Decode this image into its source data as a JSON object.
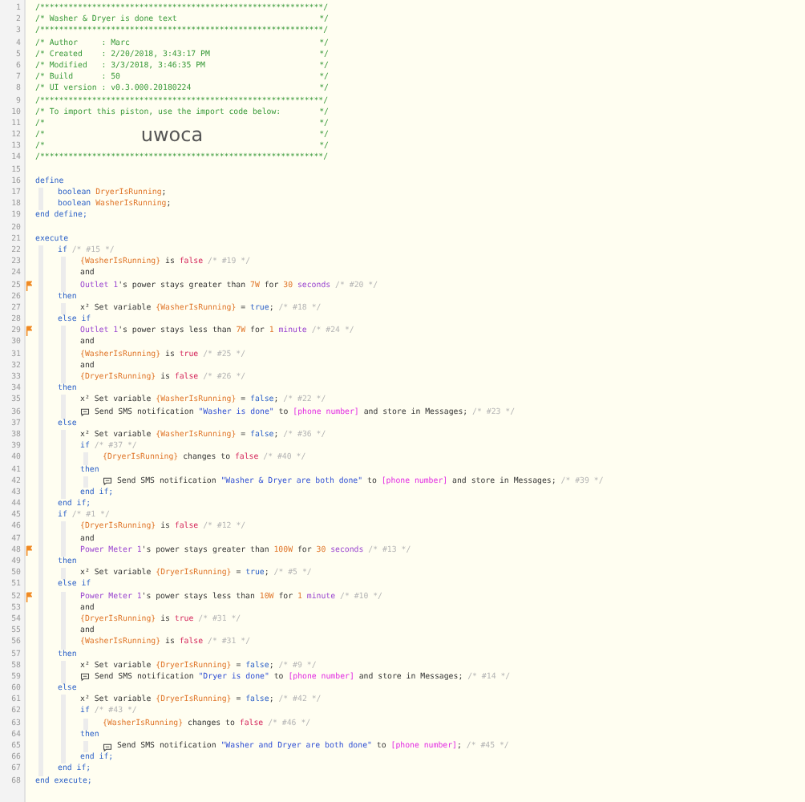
{
  "lines": [
    {
      "number": "1",
      "flagged": false,
      "tokens": [
        {
          "kind": "comment",
          "text": "/************************************************************/"
        }
      ]
    },
    {
      "number": "2",
      "flagged": false,
      "tokens": [
        {
          "kind": "comment",
          "text": "/* Washer & Dryer is done text"
        },
        {
          "kind": "comment-end",
          "text": "*/"
        }
      ]
    },
    {
      "number": "3",
      "flagged": false,
      "tokens": [
        {
          "kind": "comment",
          "text": "/************************************************************/"
        }
      ]
    },
    {
      "number": "4",
      "flagged": false,
      "tokens": [
        {
          "kind": "comment",
          "text": "/* Author     : Marc"
        },
        {
          "kind": "comment-end",
          "text": "*/"
        }
      ]
    },
    {
      "number": "5",
      "flagged": false,
      "tokens": [
        {
          "kind": "comment",
          "text": "/* Created    : 2/20/2018, 3:43:17 PM"
        },
        {
          "kind": "comment-end",
          "text": "*/"
        }
      ]
    },
    {
      "number": "6",
      "flagged": false,
      "tokens": [
        {
          "kind": "comment",
          "text": "/* Modified   : 3/3/2018, 3:46:35 PM"
        },
        {
          "kind": "comment-end",
          "text": "*/"
        }
      ]
    },
    {
      "number": "7",
      "flagged": false,
      "tokens": [
        {
          "kind": "comment",
          "text": "/* Build      : 50"
        },
        {
          "kind": "comment-end",
          "text": "*/"
        }
      ]
    },
    {
      "number": "8",
      "flagged": false,
      "tokens": [
        {
          "kind": "comment",
          "text": "/* UI version : v0.3.000.20180224"
        },
        {
          "kind": "comment-end",
          "text": "*/"
        }
      ]
    },
    {
      "number": "9",
      "flagged": false,
      "tokens": [
        {
          "kind": "comment",
          "text": "/************************************************************/"
        }
      ]
    },
    {
      "number": "10",
      "flagged": false,
      "tokens": [
        {
          "kind": "comment",
          "text": "/* To import this piston, use the import code below:"
        },
        {
          "kind": "comment-end",
          "text": "*/"
        }
      ]
    },
    {
      "number": "11",
      "flagged": false,
      "tokens": [
        {
          "kind": "comment",
          "text": "/*"
        },
        {
          "kind": "comment-end",
          "text": "*/"
        }
      ]
    },
    {
      "number": "12",
      "flagged": false,
      "tokens": [
        {
          "kind": "comment",
          "text": "/*"
        },
        {
          "kind": "banner",
          "text": "uwoca"
        },
        {
          "kind": "comment-end",
          "text": "*/"
        }
      ]
    },
    {
      "number": "13",
      "flagged": false,
      "tokens": [
        {
          "kind": "comment",
          "text": "/*"
        },
        {
          "kind": "comment-end",
          "text": "*/"
        }
      ]
    },
    {
      "number": "14",
      "flagged": false,
      "tokens": [
        {
          "kind": "comment",
          "text": "/************************************************************/"
        }
      ]
    },
    {
      "number": "15",
      "flagged": false
    },
    {
      "number": "16",
      "flagged": false,
      "tokens": [
        {
          "kind": "keyword",
          "text": "define"
        }
      ],
      "children": [
        {
          "number": "17",
          "flagged": false,
          "tokens": [
            {
              "kind": "keyword",
              "text": "boolean "
            },
            {
              "kind": "variable",
              "text": "DryerIsRunning"
            },
            {
              "kind": "plain",
              "text": ";"
            }
          ]
        },
        {
          "number": "18",
          "flagged": false,
          "tokens": [
            {
              "kind": "keyword",
              "text": "boolean "
            },
            {
              "kind": "variable",
              "text": "WasherIsRunning"
            },
            {
              "kind": "plain",
              "text": ";"
            }
          ]
        }
      ]
    },
    {
      "number": "19",
      "flagged": false,
      "tokens": [
        {
          "kind": "keyword",
          "text": "end define;"
        }
      ]
    },
    {
      "number": "20",
      "flagged": false
    },
    {
      "number": "21",
      "flagged": false,
      "tokens": [
        {
          "kind": "keyword",
          "text": "execute"
        }
      ],
      "children": [
        {
          "number": "22",
          "flagged": false,
          "tokens": [
            {
              "kind": "keyword",
              "text": "if "
            },
            {
              "kind": "note",
              "text": "/* #15 */"
            }
          ],
          "children": [
            {
              "number": "23",
              "flagged": false,
              "tokens": [
                {
                  "kind": "variable",
                  "text": "{WasherIsRunning}"
                },
                {
                  "kind": "plain",
                  "text": " is "
                },
                {
                  "kind": "bool",
                  "text": "false"
                },
                {
                  "kind": "note",
                  "text": " /* #19 */"
                }
              ]
            },
            {
              "number": "24",
              "flagged": false,
              "tokens": [
                {
                  "kind": "plain",
                  "text": "and"
                }
              ]
            },
            {
              "number": "25",
              "flagged": true,
              "tokens": [
                {
                  "kind": "device",
                  "text": "Outlet 1"
                },
                {
                  "kind": "plain",
                  "text": "'s power stays greater than "
                },
                {
                  "kind": "number",
                  "text": "7W"
                },
                {
                  "kind": "plain",
                  "text": " for "
                },
                {
                  "kind": "number",
                  "text": "30"
                },
                {
                  "kind": "unit",
                  "text": " seconds"
                },
                {
                  "kind": "note",
                  "text": " /* #20 */"
                }
              ]
            }
          ]
        },
        {
          "number": "26",
          "flagged": false,
          "tokens": [
            {
              "kind": "keyword",
              "text": "then"
            }
          ],
          "children": [
            {
              "number": "27",
              "flagged": false,
              "tokens": [
                {
                  "kind": "symbol",
                  "text": "x²"
                },
                {
                  "kind": "plain",
                  "text": " Set variable "
                },
                {
                  "kind": "variable",
                  "text": "{WasherIsRunning}"
                },
                {
                  "kind": "plain",
                  "text": " = "
                },
                {
                  "kind": "keyword",
                  "text": "true"
                },
                {
                  "kind": "plain",
                  "text": ";"
                },
                {
                  "kind": "note",
                  "text": " /* #18 */"
                }
              ]
            }
          ]
        },
        {
          "number": "28",
          "flagged": false,
          "tokens": [
            {
              "kind": "keyword",
              "text": "else if"
            }
          ],
          "children": [
            {
              "number": "29",
              "flagged": true,
              "tokens": [
                {
                  "kind": "device",
                  "text": "Outlet 1"
                },
                {
                  "kind": "plain",
                  "text": "'s power stays less than "
                },
                {
                  "kind": "number",
                  "text": "7W"
                },
                {
                  "kind": "plain",
                  "text": " for "
                },
                {
                  "kind": "number",
                  "text": "1"
                },
                {
                  "kind": "unit",
                  "text": " minute"
                },
                {
                  "kind": "note",
                  "text": " /* #24 */"
                }
              ]
            },
            {
              "number": "30",
              "flagged": false,
              "tokens": [
                {
                  "kind": "plain",
                  "text": "and"
                }
              ]
            },
            {
              "number": "31",
              "flagged": false,
              "tokens": [
                {
                  "kind": "variable",
                  "text": "{WasherIsRunning}"
                },
                {
                  "kind": "plain",
                  "text": " is "
                },
                {
                  "kind": "bool",
                  "text": "true"
                },
                {
                  "kind": "note",
                  "text": " /* #25 */"
                }
              ]
            },
            {
              "number": "32",
              "flagged": false,
              "tokens": [
                {
                  "kind": "plain",
                  "text": "and"
                }
              ]
            },
            {
              "number": "33",
              "flagged": false,
              "tokens": [
                {
                  "kind": "variable",
                  "text": "{DryerIsRunning}"
                },
                {
                  "kind": "plain",
                  "text": " is "
                },
                {
                  "kind": "bool",
                  "text": "false"
                },
                {
                  "kind": "note",
                  "text": " /* #26 */"
                }
              ]
            }
          ]
        },
        {
          "number": "34",
          "flagged": false,
          "tokens": [
            {
              "kind": "keyword",
              "text": "then"
            }
          ],
          "children": [
            {
              "number": "35",
              "flagged": false,
              "tokens": [
                {
                  "kind": "symbol",
                  "text": "x²"
                },
                {
                  "kind": "plain",
                  "text": " Set variable "
                },
                {
                  "kind": "variable",
                  "text": "{WasherIsRunning}"
                },
                {
                  "kind": "plain",
                  "text": " = "
                },
                {
                  "kind": "keyword",
                  "text": "false"
                },
                {
                  "kind": "plain",
                  "text": ";"
                },
                {
                  "kind": "note",
                  "text": " /* #22 */"
                }
              ]
            },
            {
              "number": "36",
              "flagged": false,
              "tokens": [
                {
                  "kind": "sms-icon"
                },
                {
                  "kind": "plain",
                  "text": " Send SMS notification "
                },
                {
                  "kind": "string",
                  "text": "\"Washer is done\""
                },
                {
                  "kind": "plain",
                  "text": " to "
                },
                {
                  "kind": "phone",
                  "text": "[phone number]"
                },
                {
                  "kind": "plain",
                  "text": " and store in Messages;"
                },
                {
                  "kind": "note",
                  "text": " /* #23 */"
                }
              ]
            }
          ]
        },
        {
          "number": "37",
          "flagged": false,
          "tokens": [
            {
              "kind": "keyword",
              "text": "else"
            }
          ],
          "children": [
            {
              "number": "38",
              "flagged": false,
              "tokens": [
                {
                  "kind": "symbol",
                  "text": "x²"
                },
                {
                  "kind": "plain",
                  "text": " Set variable "
                },
                {
                  "kind": "variable",
                  "text": "{WasherIsRunning}"
                },
                {
                  "kind": "plain",
                  "text": " = "
                },
                {
                  "kind": "keyword",
                  "text": "false"
                },
                {
                  "kind": "plain",
                  "text": ";"
                },
                {
                  "kind": "note",
                  "text": " /* #36 */"
                }
              ]
            },
            {
              "number": "39",
              "flagged": false,
              "tokens": [
                {
                  "kind": "keyword",
                  "text": "if "
                },
                {
                  "kind": "note",
                  "text": "/* #37 */"
                }
              ],
              "children": [
                {
                  "number": "40",
                  "flagged": false,
                  "tokens": [
                    {
                      "kind": "variable",
                      "text": "{DryerIsRunning}"
                    },
                    {
                      "kind": "plain",
                      "text": " changes to "
                    },
                    {
                      "kind": "bool",
                      "text": "false"
                    },
                    {
                      "kind": "note",
                      "text": " /* #40 */"
                    }
                  ]
                }
              ]
            },
            {
              "number": "41",
              "flagged": false,
              "tokens": [
                {
                  "kind": "keyword",
                  "text": "then"
                }
              ],
              "children": [
                {
                  "number": "42",
                  "flagged": false,
                  "tokens": [
                    {
                      "kind": "sms-icon"
                    },
                    {
                      "kind": "plain",
                      "text": " Send SMS notification "
                    },
                    {
                      "kind": "string",
                      "text": "\"Washer & Dryer are both done\""
                    },
                    {
                      "kind": "plain",
                      "text": " to "
                    },
                    {
                      "kind": "phone",
                      "text": "[phone number]"
                    },
                    {
                      "kind": "plain",
                      "text": " and store in Messages;"
                    },
                    {
                      "kind": "note",
                      "text": " /* #39 */"
                    }
                  ]
                }
              ]
            },
            {
              "number": "43",
              "flagged": false,
              "tokens": [
                {
                  "kind": "keyword",
                  "text": "end if;"
                }
              ]
            }
          ]
        },
        {
          "number": "44",
          "flagged": false,
          "tokens": [
            {
              "kind": "keyword",
              "text": "end if;"
            }
          ]
        },
        {
          "number": "45",
          "flagged": false,
          "tokens": [
            {
              "kind": "keyword",
              "text": "if "
            },
            {
              "kind": "note",
              "text": "/* #1 */"
            }
          ],
          "children": [
            {
              "number": "46",
              "flagged": false,
              "tokens": [
                {
                  "kind": "variable",
                  "text": "{DryerIsRunning}"
                },
                {
                  "kind": "plain",
                  "text": " is "
                },
                {
                  "kind": "bool",
                  "text": "false"
                },
                {
                  "kind": "note",
                  "text": " /* #12 */"
                }
              ]
            },
            {
              "number": "47",
              "flagged": false,
              "tokens": [
                {
                  "kind": "plain",
                  "text": "and"
                }
              ]
            },
            {
              "number": "48",
              "flagged": true,
              "tokens": [
                {
                  "kind": "device",
                  "text": "Power Meter 1"
                },
                {
                  "kind": "plain",
                  "text": "'s power stays greater than "
                },
                {
                  "kind": "number",
                  "text": "100W"
                },
                {
                  "kind": "plain",
                  "text": " for "
                },
                {
                  "kind": "number",
                  "text": "30"
                },
                {
                  "kind": "unit",
                  "text": " seconds"
                },
                {
                  "kind": "note",
                  "text": " /* #13 */"
                }
              ]
            }
          ]
        },
        {
          "number": "49",
          "flagged": false,
          "tokens": [
            {
              "kind": "keyword",
              "text": "then"
            }
          ],
          "children": [
            {
              "number": "50",
              "flagged": false,
              "tokens": [
                {
                  "kind": "symbol",
                  "text": "x²"
                },
                {
                  "kind": "plain",
                  "text": " Set variable "
                },
                {
                  "kind": "variable",
                  "text": "{DryerIsRunning}"
                },
                {
                  "kind": "plain",
                  "text": " = "
                },
                {
                  "kind": "keyword",
                  "text": "true"
                },
                {
                  "kind": "plain",
                  "text": ";"
                },
                {
                  "kind": "note",
                  "text": " /* #5 */"
                }
              ]
            }
          ]
        },
        {
          "number": "51",
          "flagged": false,
          "tokens": [
            {
              "kind": "keyword",
              "text": "else if"
            }
          ],
          "children": [
            {
              "number": "52",
              "flagged": true,
              "tokens": [
                {
                  "kind": "device",
                  "text": "Power Meter 1"
                },
                {
                  "kind": "plain",
                  "text": "'s power stays less than "
                },
                {
                  "kind": "number",
                  "text": "10W"
                },
                {
                  "kind": "plain",
                  "text": " for "
                },
                {
                  "kind": "number",
                  "text": "1"
                },
                {
                  "kind": "unit",
                  "text": " minute"
                },
                {
                  "kind": "note",
                  "text": " /* #10 */"
                }
              ]
            },
            {
              "number": "53",
              "flagged": false,
              "tokens": [
                {
                  "kind": "plain",
                  "text": "and"
                }
              ]
            },
            {
              "number": "54",
              "flagged": false,
              "tokens": [
                {
                  "kind": "variable",
                  "text": "{DryerIsRunning}"
                },
                {
                  "kind": "plain",
                  "text": " is "
                },
                {
                  "kind": "bool",
                  "text": "true"
                },
                {
                  "kind": "note",
                  "text": " /* #31 */"
                }
              ]
            },
            {
              "number": "55",
              "flagged": false,
              "tokens": [
                {
                  "kind": "plain",
                  "text": "and"
                }
              ]
            },
            {
              "number": "56",
              "flagged": false,
              "tokens": [
                {
                  "kind": "variable",
                  "text": "{WasherIsRunning}"
                },
                {
                  "kind": "plain",
                  "text": " is "
                },
                {
                  "kind": "bool",
                  "text": "false"
                },
                {
                  "kind": "note",
                  "text": " /* #31 */"
                }
              ]
            }
          ]
        },
        {
          "number": "57",
          "flagged": false,
          "tokens": [
            {
              "kind": "keyword",
              "text": "then"
            }
          ],
          "children": [
            {
              "number": "58",
              "flagged": false,
              "tokens": [
                {
                  "kind": "symbol",
                  "text": "x²"
                },
                {
                  "kind": "plain",
                  "text": " Set variable "
                },
                {
                  "kind": "variable",
                  "text": "{DryerIsRunning}"
                },
                {
                  "kind": "plain",
                  "text": " = "
                },
                {
                  "kind": "keyword",
                  "text": "false"
                },
                {
                  "kind": "plain",
                  "text": ";"
                },
                {
                  "kind": "note",
                  "text": " /* #9 */"
                }
              ]
            },
            {
              "number": "59",
              "flagged": false,
              "tokens": [
                {
                  "kind": "sms-icon"
                },
                {
                  "kind": "plain",
                  "text": " Send SMS notification "
                },
                {
                  "kind": "string",
                  "text": "\"Dryer is done\""
                },
                {
                  "kind": "plain",
                  "text": " to "
                },
                {
                  "kind": "phone",
                  "text": "[phone number]"
                },
                {
                  "kind": "plain",
                  "text": " and store in Messages;"
                },
                {
                  "kind": "note",
                  "text": " /* #14 */"
                }
              ]
            }
          ]
        },
        {
          "number": "60",
          "flagged": false,
          "tokens": [
            {
              "kind": "keyword",
              "text": "else"
            }
          ],
          "children": [
            {
              "number": "61",
              "flagged": false,
              "tokens": [
                {
                  "kind": "symbol",
                  "text": "x²"
                },
                {
                  "kind": "plain",
                  "text": " Set variable "
                },
                {
                  "kind": "variable",
                  "text": "{DryerIsRunning}"
                },
                {
                  "kind": "plain",
                  "text": " = "
                },
                {
                  "kind": "keyword",
                  "text": "false"
                },
                {
                  "kind": "plain",
                  "text": ";"
                },
                {
                  "kind": "note",
                  "text": " /* #42 */"
                }
              ]
            },
            {
              "number": "62",
              "flagged": false,
              "tokens": [
                {
                  "kind": "keyword",
                  "text": "if "
                },
                {
                  "kind": "note",
                  "text": "/* #43 */"
                }
              ],
              "children": [
                {
                  "number": "63",
                  "flagged": false,
                  "tokens": [
                    {
                      "kind": "variable",
                      "text": "{WasherIsRunning}"
                    },
                    {
                      "kind": "plain",
                      "text": " changes to "
                    },
                    {
                      "kind": "bool",
                      "text": "false"
                    },
                    {
                      "kind": "note",
                      "text": " /* #46 */"
                    }
                  ]
                }
              ]
            },
            {
              "number": "64",
              "flagged": false,
              "tokens": [
                {
                  "kind": "keyword",
                  "text": "then"
                }
              ],
              "children": [
                {
                  "number": "65",
                  "flagged": false,
                  "tokens": [
                    {
                      "kind": "sms-icon"
                    },
                    {
                      "kind": "plain",
                      "text": " Send SMS notification "
                    },
                    {
                      "kind": "string",
                      "text": "\"Washer and Dryer are both done\""
                    },
                    {
                      "kind": "plain",
                      "text": " to "
                    },
                    {
                      "kind": "phone",
                      "text": "[phone number]"
                    },
                    {
                      "kind": "plain",
                      "text": ";"
                    },
                    {
                      "kind": "note",
                      "text": " /* #45 */"
                    }
                  ]
                }
              ]
            },
            {
              "number": "66",
              "flagged": false,
              "tokens": [
                {
                  "kind": "keyword",
                  "text": "end if;"
                }
              ]
            }
          ]
        },
        {
          "number": "67",
          "flagged": false,
          "tokens": [
            {
              "kind": "keyword",
              "text": "end if;"
            }
          ]
        }
      ]
    },
    {
      "number": "68",
      "flagged": false,
      "tokens": [
        {
          "kind": "keyword",
          "text": "end execute;"
        }
      ]
    }
  ]
}
